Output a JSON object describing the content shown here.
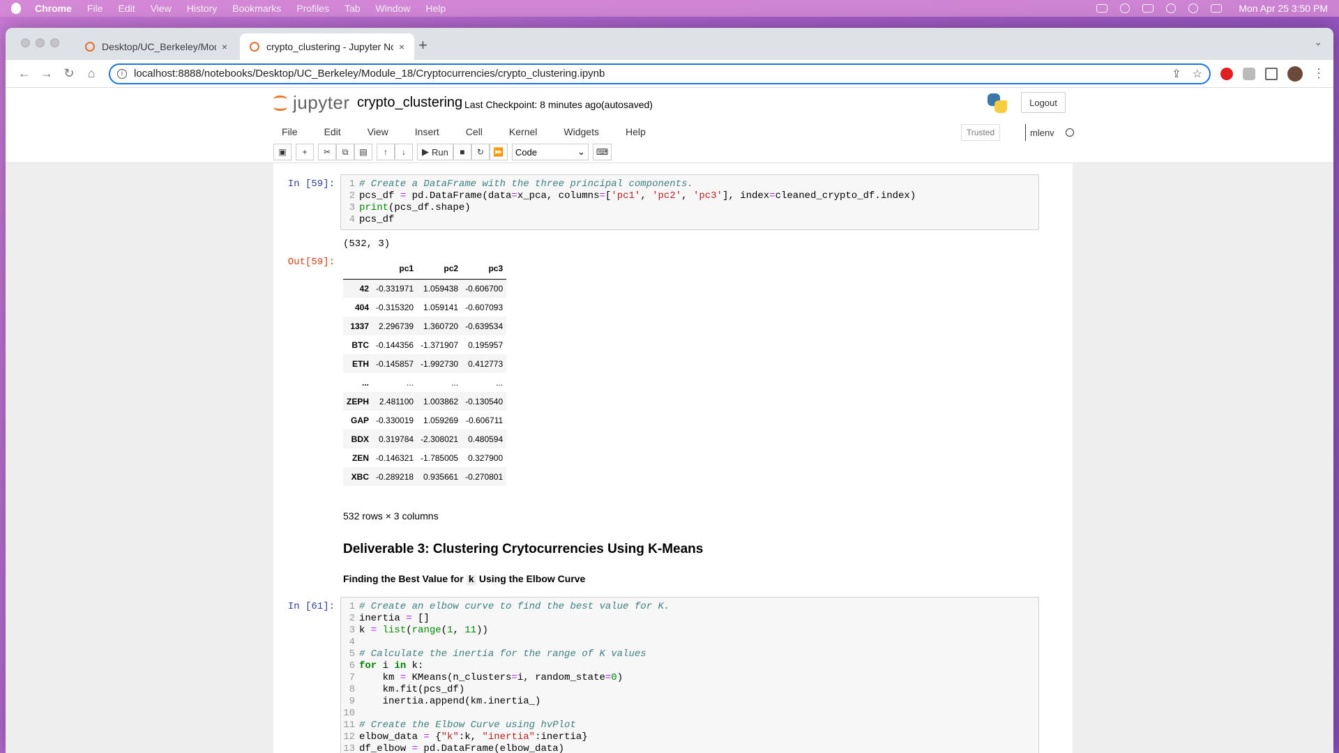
{
  "menubar": {
    "app": "Chrome",
    "items": [
      "File",
      "Edit",
      "View",
      "History",
      "Bookmarks",
      "Profiles",
      "Tab",
      "Window",
      "Help"
    ],
    "clock": "Mon Apr 25  3:50 PM"
  },
  "tabs": [
    {
      "label": "Desktop/UC_Berkeley/Module_",
      "close": "×"
    },
    {
      "label": "crypto_clustering - Jupyter No",
      "close": "×"
    }
  ],
  "newtab": "+",
  "address": {
    "url": "localhost:8888/notebooks/Desktop/UC_Berkeley/Module_18/Cryptocurrencies/crypto_clustering.ipynb"
  },
  "jupyter": {
    "logo": "jupyter",
    "notebook_name": "crypto_clustering",
    "checkpoint": "Last Checkpoint: 8 minutes ago",
    "autosave": "(autosaved)",
    "logout": "Logout",
    "menu": [
      "File",
      "Edit",
      "View",
      "Insert",
      "Cell",
      "Kernel",
      "Widgets",
      "Help"
    ],
    "trusted": "Trusted",
    "kernel": "mlenv",
    "run_label": "Run",
    "cell_type": "Code"
  },
  "cells": {
    "cell59": {
      "prompt_in": "In [59]:",
      "prompt_out": "Out[59]:",
      "stdout": "(532, 3)"
    },
    "dataframe": {
      "columns": [
        "",
        "pc1",
        "pc2",
        "pc3"
      ],
      "rows": [
        [
          "42",
          "-0.331971",
          "1.059438",
          "-0.606700"
        ],
        [
          "404",
          "-0.315320",
          "1.059141",
          "-0.607093"
        ],
        [
          "1337",
          "2.296739",
          "1.360720",
          "-0.639534"
        ],
        [
          "BTC",
          "-0.144356",
          "-1.371907",
          "0.195957"
        ],
        [
          "ETH",
          "-0.145857",
          "-1.992730",
          "0.412773"
        ],
        [
          "...",
          "...",
          "...",
          "..."
        ],
        [
          "ZEPH",
          "2.481100",
          "1.003862",
          "-0.130540"
        ],
        [
          "GAP",
          "-0.330019",
          "1.059269",
          "-0.606711"
        ],
        [
          "BDX",
          "0.319784",
          "-2.308021",
          "0.480594"
        ],
        [
          "ZEN",
          "-0.146321",
          "-1.785005",
          "0.327900"
        ],
        [
          "XBC",
          "-0.289218",
          "0.935661",
          "-0.270801"
        ]
      ],
      "dims": "532 rows × 3 columns"
    },
    "markdown": {
      "h3": "Deliverable 3: Clustering Crytocurrencies Using K-Means",
      "h4_pre": "Finding the Best Value for ",
      "h4_code": "k",
      "h4_post": " Using the Elbow Curve"
    },
    "cell61": {
      "prompt_in": "In [61]:"
    }
  }
}
